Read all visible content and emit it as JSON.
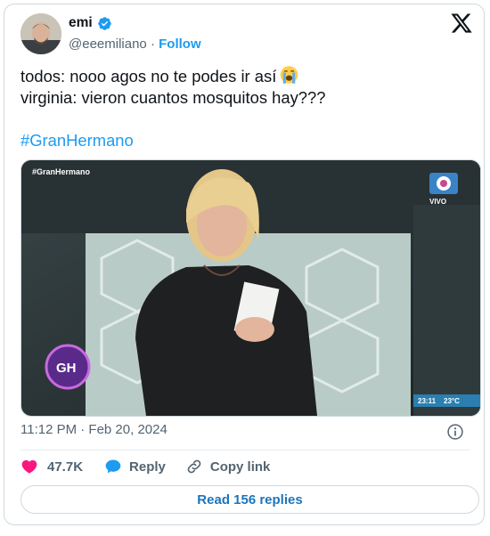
{
  "author": {
    "name": "emi",
    "handle": "@eeemiliano",
    "separator": "·",
    "follow_label": "Follow"
  },
  "tweet": {
    "line1": "todos: nooo agos no te podes ir así",
    "line2": "virginia: vieron cuantos mosquitos hay???",
    "emoji": "loudly-crying-face",
    "hashtag": "#GranHermano"
  },
  "media": {
    "watermark": "#GranHermano",
    "live_label": "VIVO",
    "logo_text": "GH",
    "clock": "23:11",
    "temperature": "23°C"
  },
  "timestamp": "11:12 PM · Feb 20, 2024",
  "actions": {
    "likes": "47.7K",
    "reply_label": "Reply",
    "copy_label": "Copy link"
  },
  "read_replies_label": "Read 156 replies",
  "colors": {
    "accent": "#1d9bf0",
    "like": "#f91880",
    "secondary_text": "#536471"
  }
}
